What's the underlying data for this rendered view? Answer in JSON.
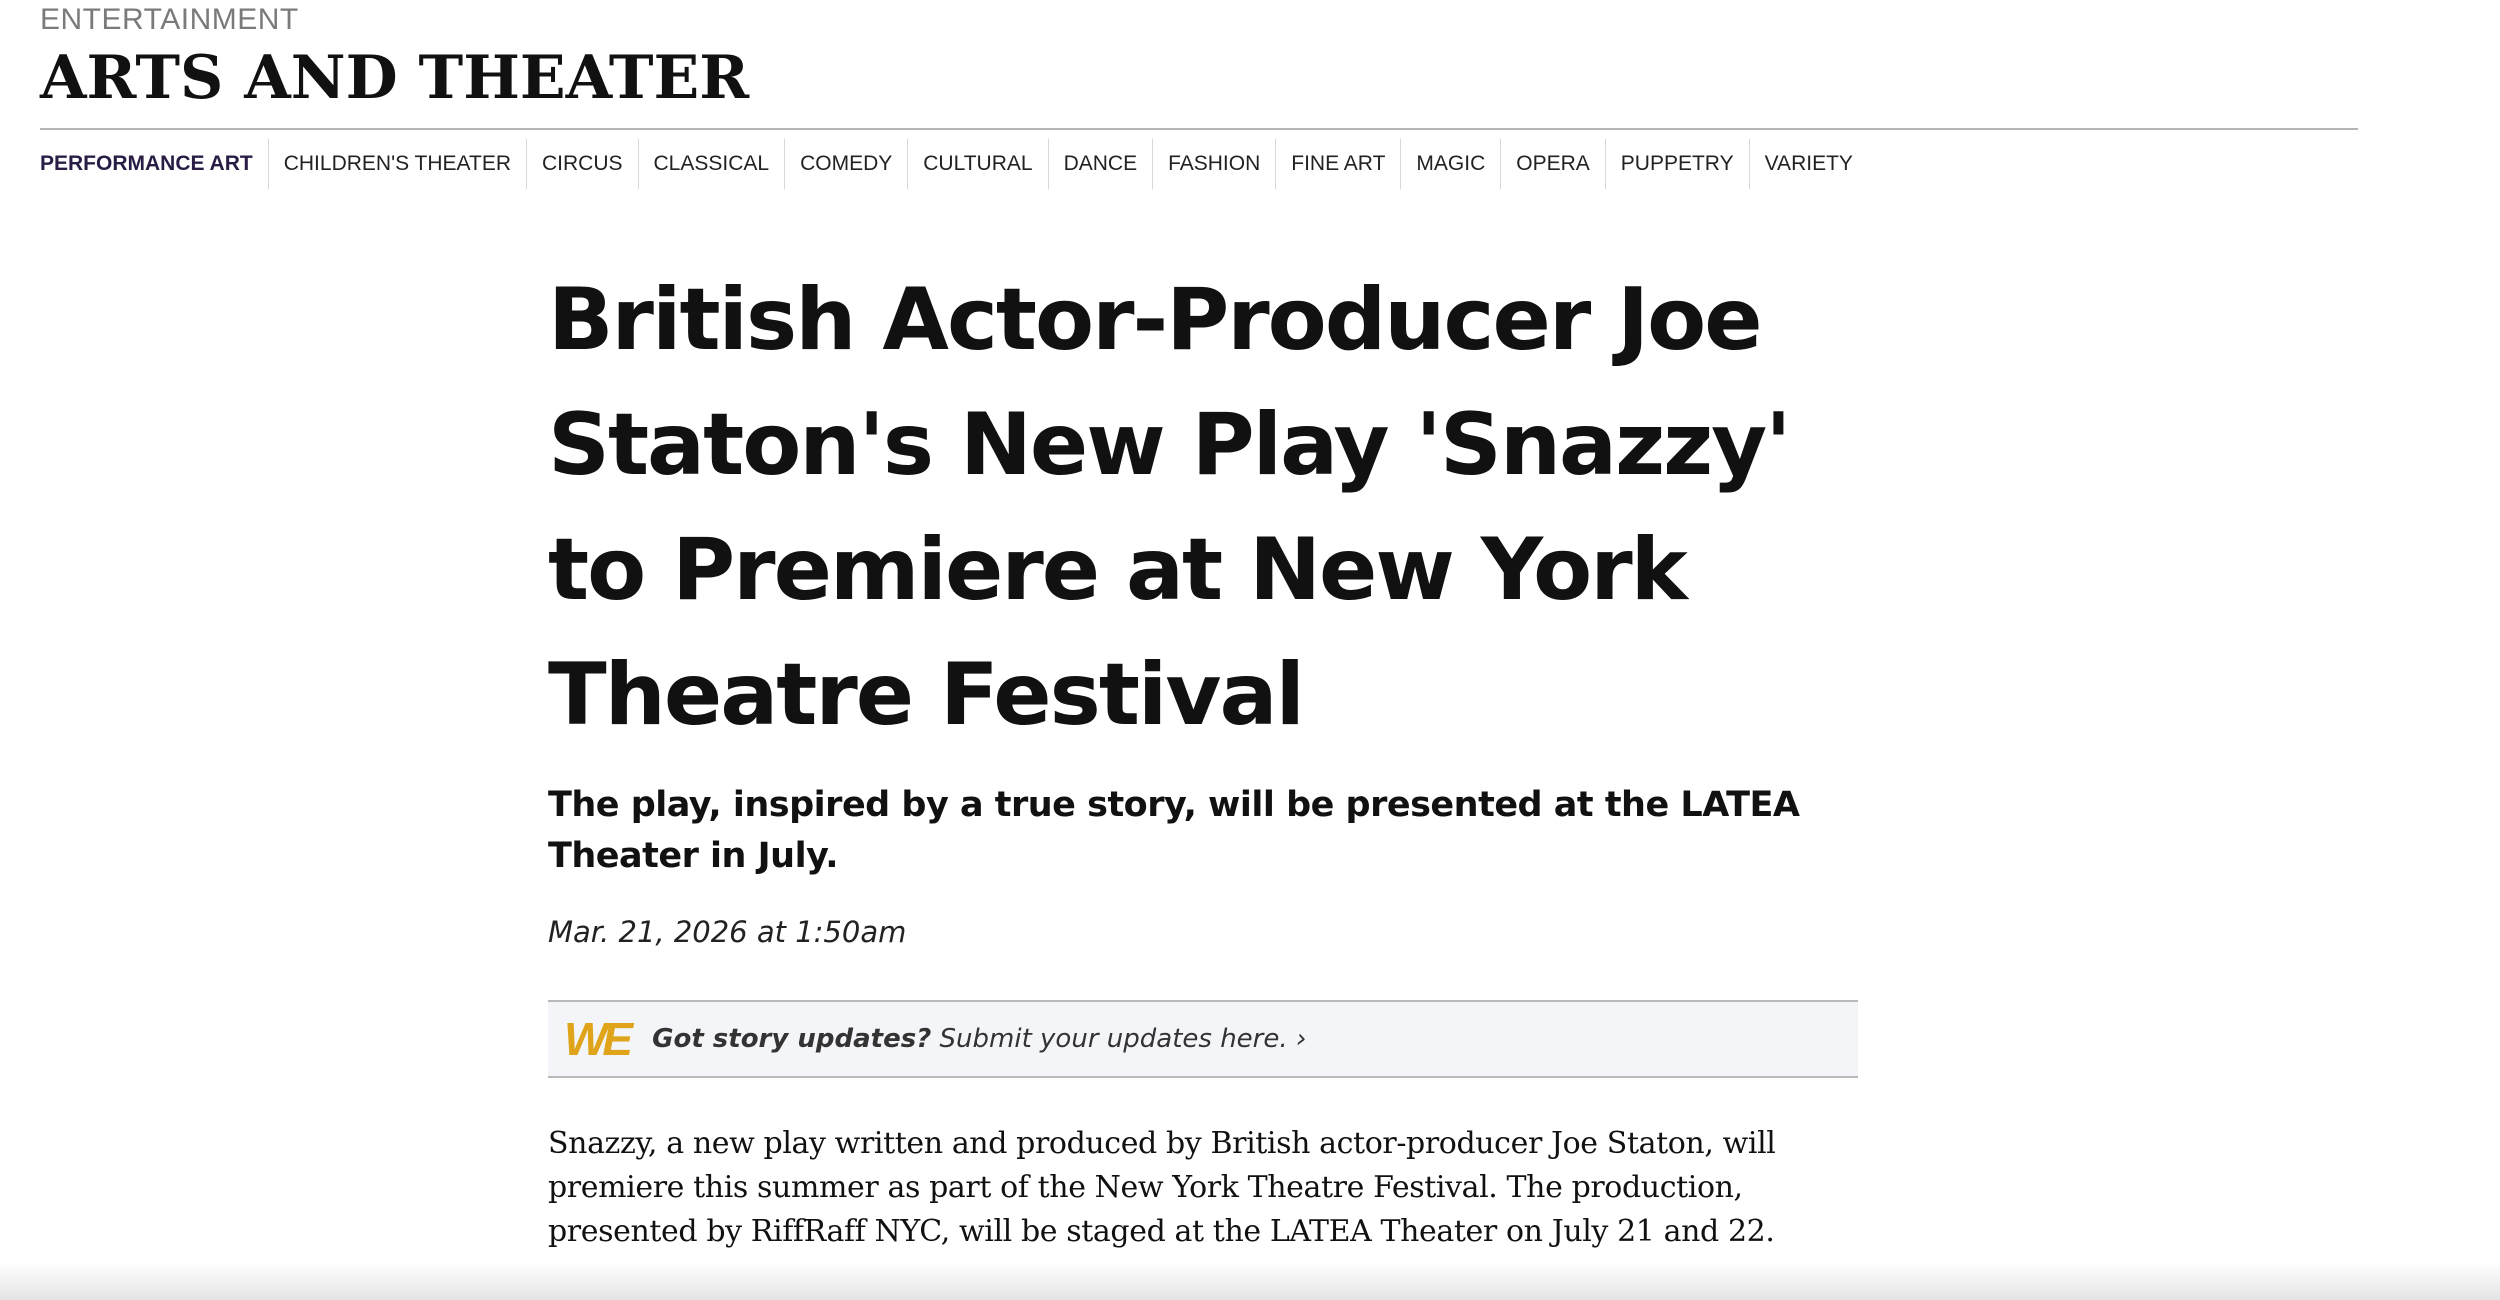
{
  "header": {
    "kicker": "ENTERTAINMENT",
    "title": "ARTS AND THEATER"
  },
  "subnav": {
    "items": [
      {
        "label": "PERFORMANCE ART",
        "active": true
      },
      {
        "label": "CHILDREN'S THEATER",
        "active": false
      },
      {
        "label": "CIRCUS",
        "active": false
      },
      {
        "label": "CLASSICAL",
        "active": false
      },
      {
        "label": "COMEDY",
        "active": false
      },
      {
        "label": "CULTURAL",
        "active": false
      },
      {
        "label": "DANCE",
        "active": false
      },
      {
        "label": "FASHION",
        "active": false
      },
      {
        "label": "FINE ART",
        "active": false
      },
      {
        "label": "MAGIC",
        "active": false
      },
      {
        "label": "OPERA",
        "active": false
      },
      {
        "label": "PUPPETRY",
        "active": false
      },
      {
        "label": "VARIETY",
        "active": false
      }
    ]
  },
  "article": {
    "headline": "British Actor-Producer Joe Staton's New Play 'Snazzy' to Premiere at New York Theatre Festival",
    "dek": "The play, inspired by a true story, will be presented at the LATEA Theater in July.",
    "date": "Mar. 21, 2026 at 1:50am",
    "updates": {
      "logo": "WE",
      "prompt": "Got story updates?",
      "link": "Submit your updates here. ›"
    },
    "body": "Snazzy, a new play written and produced by British actor-producer Joe Staton, will premiere this summer as part of the New York Theatre Festival. The production, presented by RiffRaff NYC, will be staged at the LATEA Theater on July 21 and 22."
  },
  "colors": {
    "active_nav": "#2a1d45",
    "logo_accent": "#e0a41b",
    "updates_bg": "#f4f5f8"
  }
}
